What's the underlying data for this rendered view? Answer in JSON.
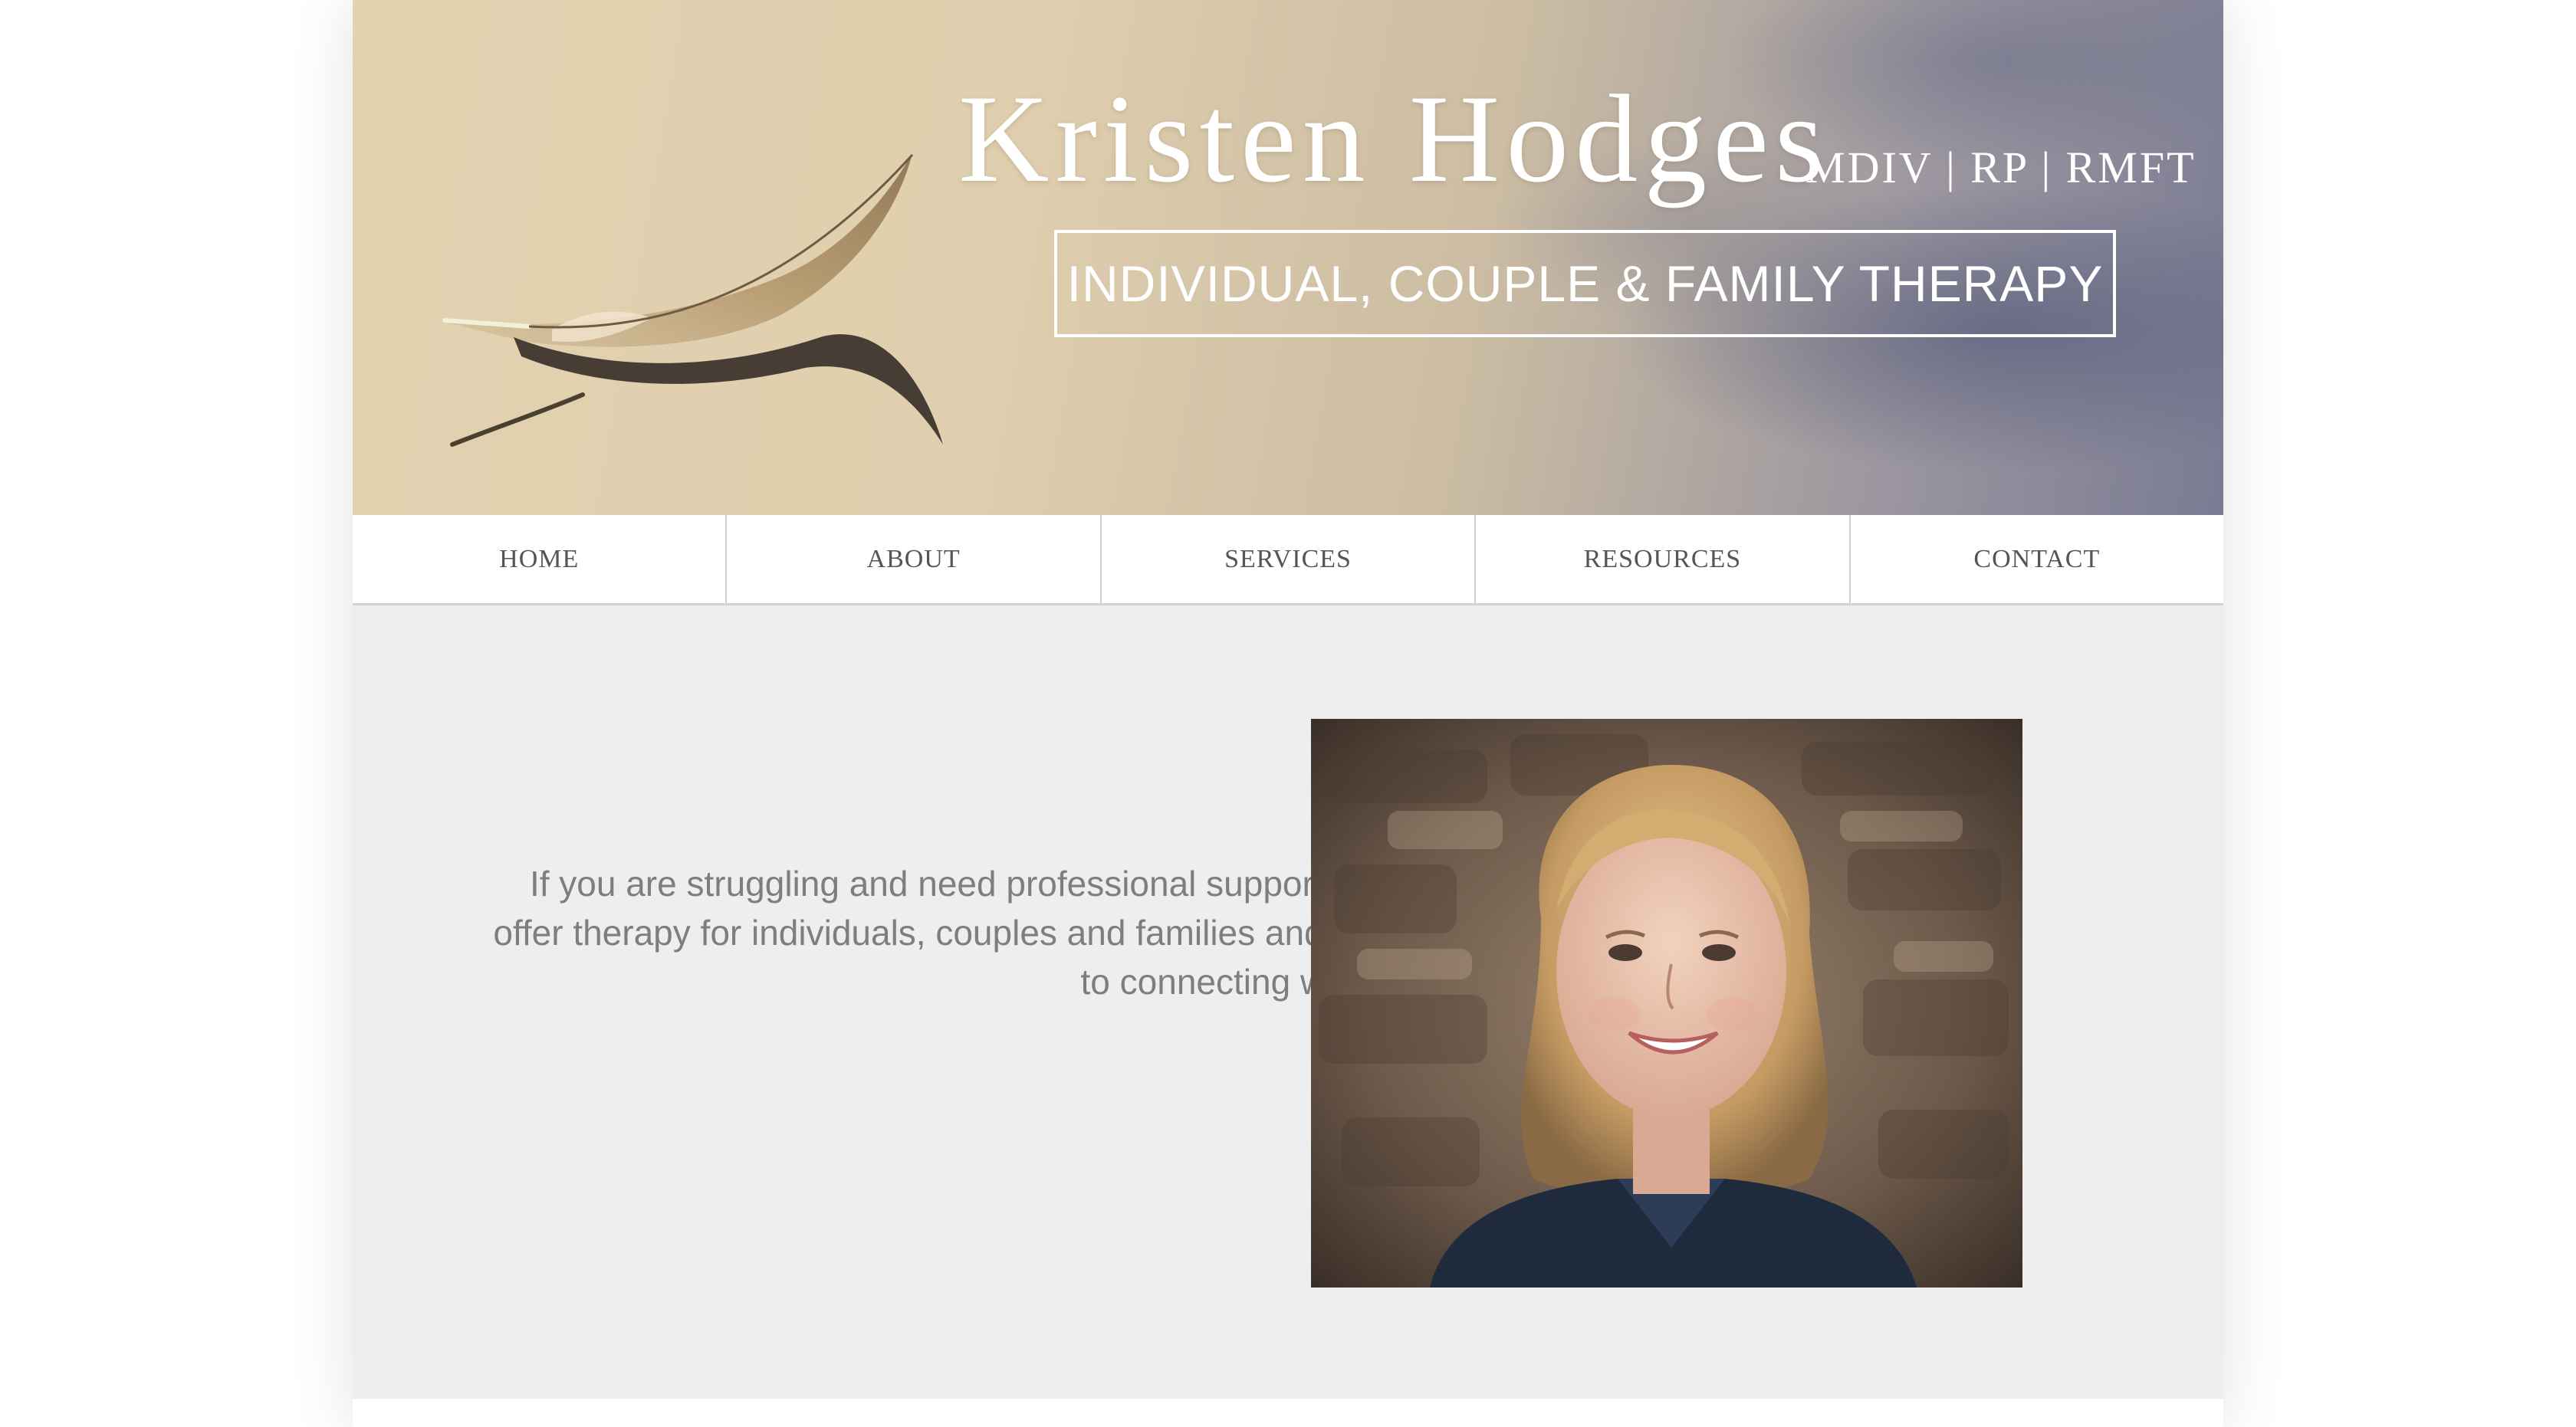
{
  "header": {
    "name": "Kristen Hodges",
    "credentials": "MDIV | RP | RMFT",
    "tagline": "INDIVIDUAL, COUPLE & FAMILY THERAPY",
    "banner_image": "feather-on-water"
  },
  "nav": {
    "items": [
      {
        "label": "HOME"
      },
      {
        "label": "ABOUT"
      },
      {
        "label": "SERVICES"
      },
      {
        "label": "RESOURCES"
      },
      {
        "label": "CONTACT"
      }
    ]
  },
  "main": {
    "intro_text": "If you are struggling and need professional support, I can help. I offer therapy for individuals, couples and families and look forward to connecting with you soon.",
    "portrait_image": "portrait-photo"
  },
  "colors": {
    "nav_text": "#555555",
    "body_text": "#7e7e7e",
    "content_background": "#eeeeee"
  }
}
